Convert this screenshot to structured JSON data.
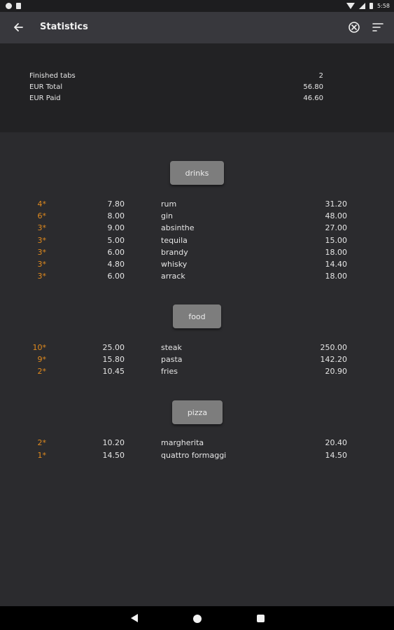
{
  "status_bar": {
    "time": "5:58"
  },
  "app_bar": {
    "title": "Statistics"
  },
  "summary": {
    "rows": [
      {
        "label": "Finished tabs",
        "value": "2"
      },
      {
        "label": "EUR Total",
        "value": "56.80"
      },
      {
        "label": "EUR Paid",
        "value": "46.60"
      }
    ]
  },
  "sections": [
    {
      "label": "drinks",
      "items": [
        {
          "qty": "4*",
          "price": "7.80",
          "name": "rum",
          "total": "31.20"
        },
        {
          "qty": "6*",
          "price": "8.00",
          "name": "gin",
          "total": "48.00"
        },
        {
          "qty": "3*",
          "price": "9.00",
          "name": "absinthe",
          "total": "27.00"
        },
        {
          "qty": "3*",
          "price": "5.00",
          "name": "tequila",
          "total": "15.00"
        },
        {
          "qty": "3*",
          "price": "6.00",
          "name": "brandy",
          "total": "18.00"
        },
        {
          "qty": "3*",
          "price": "4.80",
          "name": "whisky",
          "total": "14.40"
        },
        {
          "qty": "3*",
          "price": "6.00",
          "name": "arrack",
          "total": "18.00"
        }
      ]
    },
    {
      "label": "food",
      "items": [
        {
          "qty": "10*",
          "price": "25.00",
          "name": "steak",
          "total": "250.00"
        },
        {
          "qty": "9*",
          "price": "15.80",
          "name": "pasta",
          "total": "142.20"
        },
        {
          "qty": "2*",
          "price": "10.45",
          "name": "fries",
          "total": "20.90"
        }
      ]
    },
    {
      "label": "pizza",
      "items": [
        {
          "qty": "2*",
          "price": "10.20",
          "name": "margherita",
          "total": "20.40"
        },
        {
          "qty": "1*",
          "price": "14.50",
          "name": "quattro formaggi",
          "total": "14.50"
        }
      ]
    }
  ],
  "colors": {
    "background": "#2b2b2e",
    "app_bar": "#38383d",
    "summary_panel": "#222224",
    "section_button": "#7d7d7d",
    "quantity_accent": "#e08a1e"
  },
  "icons": {
    "back": "arrow-back-icon",
    "clear": "close-circle-icon",
    "sort": "sort-icon"
  }
}
